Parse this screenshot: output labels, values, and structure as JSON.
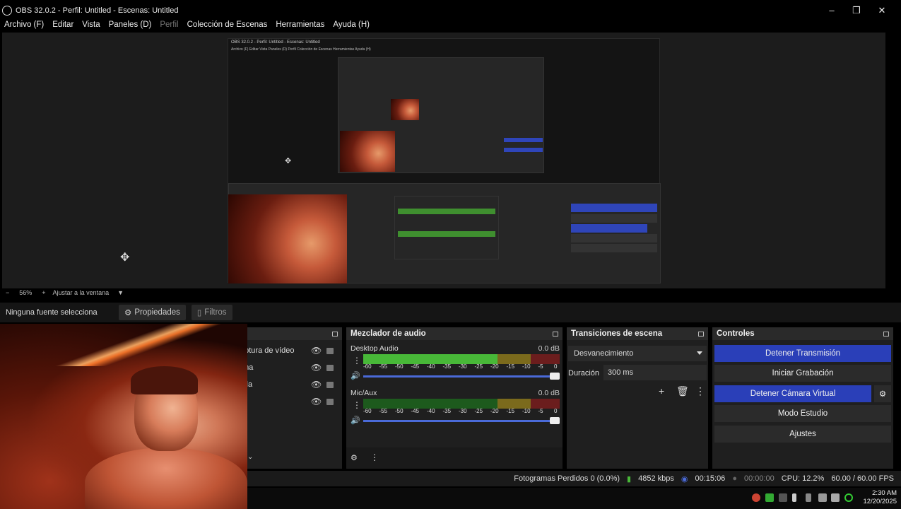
{
  "window": {
    "title": "OBS 32.0.2 - Perfil: Untitled - Escenas: Untitled",
    "minimize": "–",
    "maximize": "❐",
    "close": "✕"
  },
  "menu": [
    "Archivo (F)",
    "Editar",
    "Vista",
    "Paneles (D)",
    "Perfil",
    "Colección de Escenas",
    "Herramientas",
    "Ayuda (H)"
  ],
  "nested_preview": {
    "title": "OBS 32.0.2 - Perfil: Untitled - Escenas: Untitled",
    "menu": "Archivo (F)  Editar  Vista  Paneles (D)  Perfil  Colección de Escenas  Herramientas  Ayuda (H)"
  },
  "zoom": {
    "minus": "−",
    "value": "56%",
    "plus": "+",
    "fit": "Ajustar a la ventana"
  },
  "source_toolbar": {
    "no_selection": "Ninguna fuente seleccionada",
    "properties": "Propiedades",
    "filters": "Filtros"
  },
  "sources": {
    "items": [
      "aptura de vídeo",
      "ana",
      "alla",
      "o"
    ]
  },
  "mixer": {
    "title": "Mezclador de audio",
    "channels": [
      {
        "name": "Desktop Audio",
        "db": "0.0 dB",
        "level": 0.7
      },
      {
        "name": "Mic/Aux",
        "db": "0.0 dB",
        "level": 0.68
      }
    ],
    "ticks": [
      "-60",
      "-55",
      "-50",
      "-45",
      "-40",
      "-35",
      "-30",
      "-25",
      "-20",
      "-15",
      "-10",
      "-5",
      "0"
    ]
  },
  "transitions": {
    "title": "Transiciones de escena",
    "selected": "Desvanecimiento",
    "duration_label": "Duración",
    "duration_value": "300 ms"
  },
  "controls": {
    "title": "Controles",
    "stop_stream": "Detener Transmisión",
    "start_record": "Iniciar Grabación",
    "stop_virtualcam": "Detener Cámara Virtual",
    "studio_mode": "Modo Estudio",
    "settings": "Ajustes"
  },
  "status": {
    "dropped": "Fotogramas Perdidos 0 (0.0%)",
    "bitrate": "4852 kbps",
    "stream_time": "00:15:06",
    "record_time": "00:00:00",
    "cpu": "CPU: 12.2%",
    "fps": "60.00 / 60.00 FPS"
  },
  "clock": {
    "time": "2:30 AM",
    "date": "12/20/2025"
  },
  "colors": {
    "accent_blue": "#2a3fb8",
    "meter_green": "#48b838",
    "meter_yellow": "#7b6a1c",
    "meter_red": "#6b1d1d"
  }
}
